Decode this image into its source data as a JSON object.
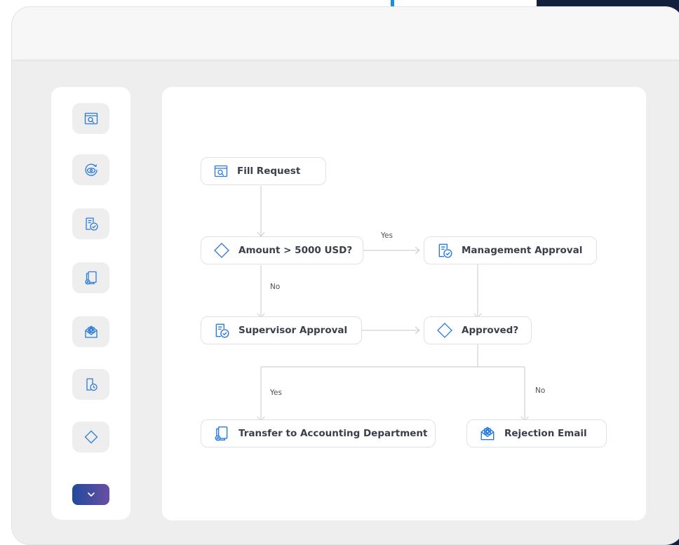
{
  "palette": {
    "accent": "#1a8fe0",
    "icon_stroke": "#2a7bd8",
    "frame_dark": "#13203d",
    "expand_gradient": [
      "#214a9c",
      "#6a4ea3"
    ]
  },
  "toolbox": {
    "tools": [
      {
        "name": "form-icon"
      },
      {
        "name": "process-icon"
      },
      {
        "name": "approval-icon"
      },
      {
        "name": "transfer-icon"
      },
      {
        "name": "email-icon"
      },
      {
        "name": "timer-icon"
      },
      {
        "name": "decision-icon"
      },
      {
        "name": "chevron-down-icon"
      }
    ]
  },
  "flow": {
    "nodes": {
      "fill_request": {
        "label": "Fill Request",
        "icon": "form-icon"
      },
      "amount_check": {
        "label": "Amount > 5000 USD?",
        "icon": "decision-icon"
      },
      "management_approval": {
        "label": "Management Approval",
        "icon": "approval-icon"
      },
      "supervisor_approval": {
        "label": "Supervisor Approval",
        "icon": "approval-icon"
      },
      "approved_check": {
        "label": "Approved?",
        "icon": "decision-icon"
      },
      "transfer_accounting": {
        "label": "Transfer to Accounting Department",
        "icon": "transfer-icon"
      },
      "rejection_email": {
        "label": "Rejection Email",
        "icon": "email-icon"
      }
    },
    "edge_labels": {
      "amount_yes": "Yes",
      "amount_no": "No",
      "approved_yes": "Yes",
      "approved_no": "No"
    }
  }
}
